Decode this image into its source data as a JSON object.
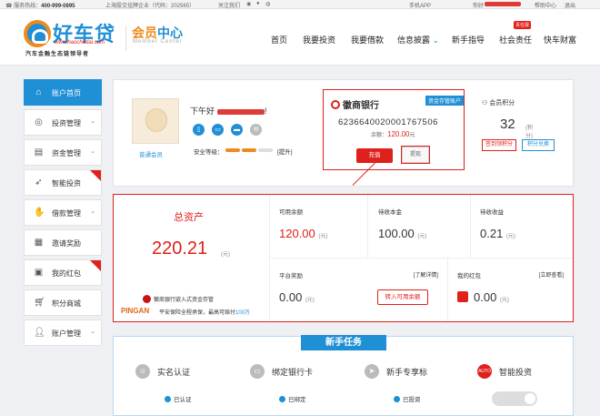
{
  "topbar": {
    "hotline_label": "服务热线：",
    "hotline": "400-999-0895",
    "listed": "上海股交挂牌企业（代码：202565）",
    "follow": "关注我们",
    "mobile_app": "手机APP",
    "greeting": "你好",
    "help": "帮助中心",
    "logout": "退出"
  },
  "header": {
    "logo_text": "好车贷",
    "logo_url": "www.haochedai.com",
    "slogan": "汽车金融生态链领导者",
    "member_center_1": "会员",
    "member_center_2": "中心",
    "member_center_en": "Member Center",
    "nav": [
      "首页",
      "我要投资",
      "我要借款",
      "信息披露",
      "新手指导",
      "社会责任",
      "快车财富"
    ],
    "nav_badge": "责任报"
  },
  "sidebar": {
    "items": [
      {
        "label": "账户首页",
        "icon": "home-icon"
      },
      {
        "label": "投资管理",
        "icon": "coins-icon"
      },
      {
        "label": "资金管理",
        "icon": "document-icon"
      },
      {
        "label": "智能投资",
        "icon": "rocket-icon"
      },
      {
        "label": "借款管理",
        "icon": "hand-coin-icon"
      },
      {
        "label": "邀请奖励",
        "icon": "gift-icon"
      },
      {
        "label": "我的红包",
        "icon": "red-envelope-icon"
      },
      {
        "label": "积分商城",
        "icon": "cart-icon"
      },
      {
        "label": "账户管理",
        "icon": "user-icon"
      }
    ]
  },
  "user": {
    "greeting": "下午好",
    "greeting_suffix": "!",
    "member_type": "普通会员",
    "safety_label": "安全等级：",
    "upgrade": "[提升]"
  },
  "bank_card": {
    "bank_name": "徽商银行",
    "tag": "资金存管账户",
    "card_no": "6236640020001767506",
    "balance_label": "余额：",
    "balance": "120.00",
    "balance_unit": "元",
    "recharge": "充值",
    "withdraw": "提现"
  },
  "points": {
    "label": "会员积分",
    "value": "32",
    "unit": "(积分)",
    "sign_btn": "签到领积分",
    "exchange_btn": "积分兑换"
  },
  "assets": {
    "total_label": "总资产",
    "total_value": "220.21",
    "unit": "(元)",
    "bank_line": "徽商银行嵌入式资金存管",
    "pingan_logo": "PINGAN",
    "pingan_text": "平安保险全程承保，最高可赔付",
    "pingan_amount": "100万",
    "available_label": "可用余额",
    "available_value": "120.00",
    "principal_label": "待收本金",
    "principal_value": "100.00",
    "income_label": "待收收益",
    "income_value": "0.21",
    "reward_label": "平台奖励",
    "reward_link": "[了解详情]",
    "reward_value": "0.00",
    "transfer_btn": "转入可用余额",
    "envelope_label": "我的红包",
    "envelope_link": "[立即查看]",
    "envelope_value": "0.00"
  },
  "tasks": {
    "title": "新手任务",
    "items": [
      {
        "name": "实名认证",
        "status": "已认证"
      },
      {
        "name": "绑定银行卡",
        "status": "已绑定"
      },
      {
        "name": "新手专享标",
        "status": "已投资"
      },
      {
        "name": "智能投资",
        "status": ""
      }
    ]
  }
}
